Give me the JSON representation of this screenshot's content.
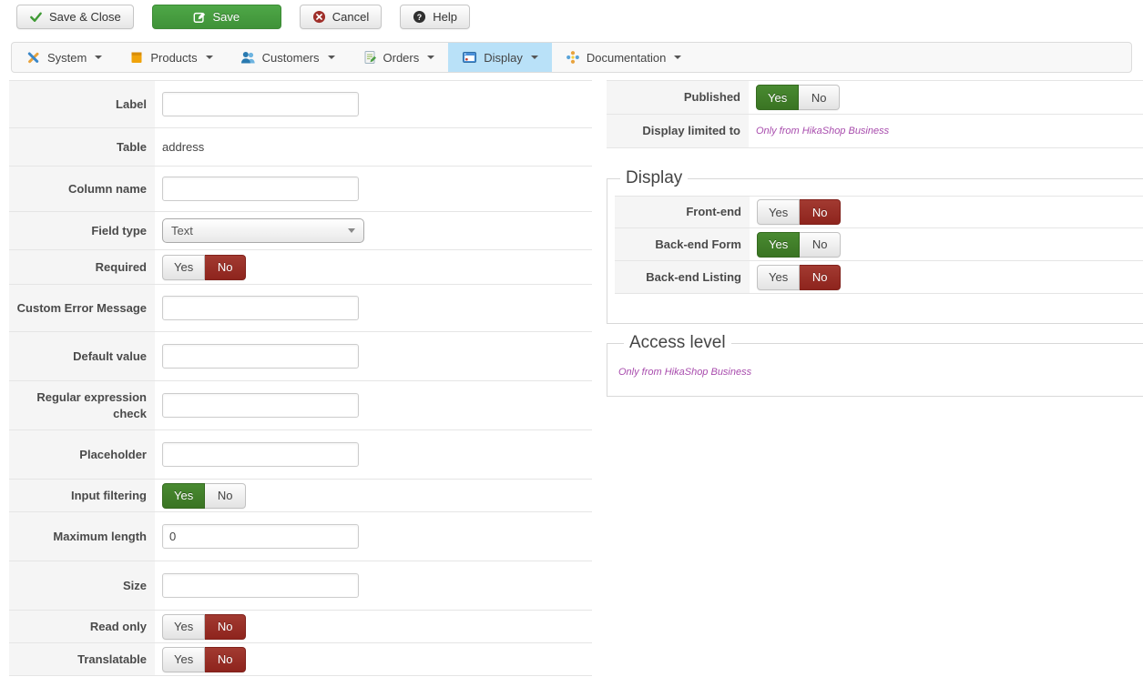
{
  "labels": {
    "yes": "Yes",
    "no": "No"
  },
  "colors": {
    "accent_green": "#3f9238",
    "toggle_green": "#3a7423",
    "toggle_red": "#8e241d",
    "menu_active_blue": "#b9e1f8",
    "link_purple": "#a84cad"
  },
  "toolbar": {
    "save_close_label": "Save & Close",
    "save_label": "Save",
    "cancel_label": "Cancel",
    "help_label": "Help",
    "icons": [
      "check-icon",
      "edit-save-icon",
      "cancel-circle-icon",
      "help-circle-icon"
    ]
  },
  "menubar": {
    "items": [
      {
        "label": "System",
        "icon": "tools-icon",
        "active": false
      },
      {
        "label": "Products",
        "icon": "box-icon",
        "active": false
      },
      {
        "label": "Customers",
        "icon": "users-icon",
        "active": false
      },
      {
        "label": "Orders",
        "icon": "order-document-icon",
        "active": false
      },
      {
        "label": "Display",
        "icon": "monitor-icon",
        "active": true
      },
      {
        "label": "Documentation",
        "icon": "pinwheel-icon",
        "active": false
      }
    ]
  },
  "left": {
    "label_field": {
      "label": "Label",
      "value": ""
    },
    "table": {
      "label": "Table",
      "value": "address"
    },
    "column_name": {
      "label": "Column name",
      "value": ""
    },
    "field_type": {
      "label": "Field type",
      "value": "Text"
    },
    "required": {
      "label": "Required",
      "value": "No"
    },
    "custom_error": {
      "label": "Custom Error Message",
      "value": ""
    },
    "default_value": {
      "label": "Default value",
      "value": ""
    },
    "regex_check": {
      "label": "Regular expression check",
      "value": ""
    },
    "placeholder": {
      "label": "Placeholder",
      "value": ""
    },
    "input_filtering": {
      "label": "Input filtering",
      "value": "Yes"
    },
    "max_length": {
      "label": "Maximum length",
      "value": "0"
    },
    "size": {
      "label": "Size",
      "value": ""
    },
    "read_only": {
      "label": "Read only",
      "value": "No"
    },
    "translatable": {
      "label": "Translatable",
      "value": "No"
    }
  },
  "right": {
    "published": {
      "label": "Published",
      "value": "Yes"
    },
    "display_limited": {
      "label": "Display limited to",
      "link": "Only from HikaShop Business"
    },
    "display_section": {
      "title": "Display",
      "front_end": {
        "label": "Front-end",
        "value": "No"
      },
      "backend_form": {
        "label": "Back-end Form",
        "value": "Yes"
      },
      "backend_listing": {
        "label": "Back-end Listing",
        "value": "No"
      }
    },
    "access_section": {
      "title": "Access level",
      "link": "Only from HikaShop Business"
    }
  }
}
